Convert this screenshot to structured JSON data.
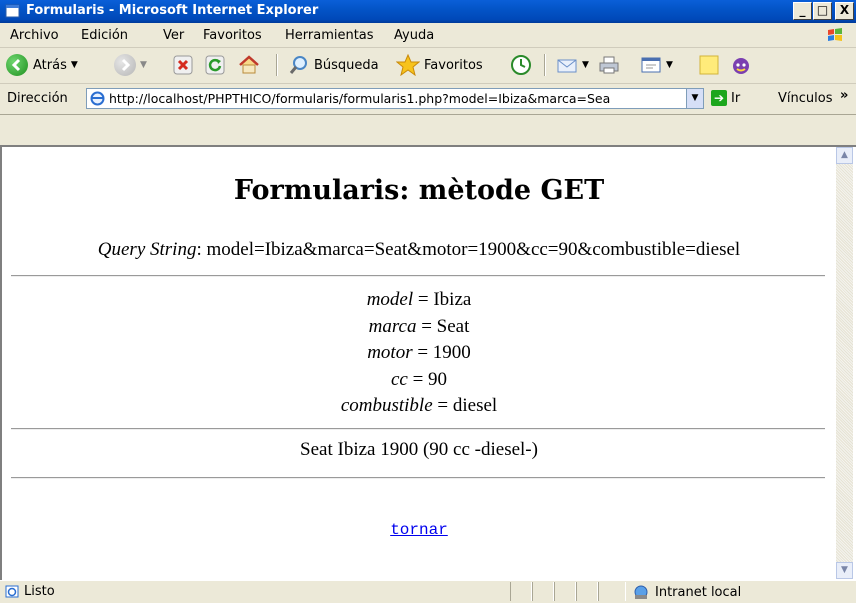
{
  "window": {
    "title": "Formularis - Microsoft Internet Explorer",
    "btn_min": "_",
    "btn_max": "□",
    "btn_close": "X"
  },
  "menu": [
    "Archivo",
    "Edición",
    "Ver",
    "Favoritos",
    "Herramientas",
    "Ayuda"
  ],
  "toolbar": {
    "back_label": "Atrás",
    "search_label": "Búsqueda",
    "favorites_label": "Favoritos"
  },
  "address": {
    "label": "Dirección",
    "url": "http://localhost/PHPTHICO/formularis/formularis1.php?model=Ibiza&marca=Sea",
    "go_label": "Ir",
    "links_label": "Vínculos"
  },
  "page": {
    "heading": "Formularis: mètode GET",
    "qs_label": "Query String",
    "qs_value": ": model=Ibiza&marca=Seat&motor=1900&cc=90&combustible=diesel",
    "params": [
      {
        "name": "model",
        "value": " = Ibiza"
      },
      {
        "name": "marca",
        "value": " = Seat"
      },
      {
        "name": "motor",
        "value": " = 1900"
      },
      {
        "name": "cc",
        "value": " = 90"
      },
      {
        "name": "combustible",
        "value": " = diesel"
      }
    ],
    "summary": "Seat Ibiza 1900 (90 cc -diesel-)",
    "back_link": "tornar"
  },
  "status": {
    "text": "Listo",
    "zone": "Intranet local"
  },
  "colors": {
    "titlebar": "#0054e3",
    "link": "#0000ee"
  }
}
